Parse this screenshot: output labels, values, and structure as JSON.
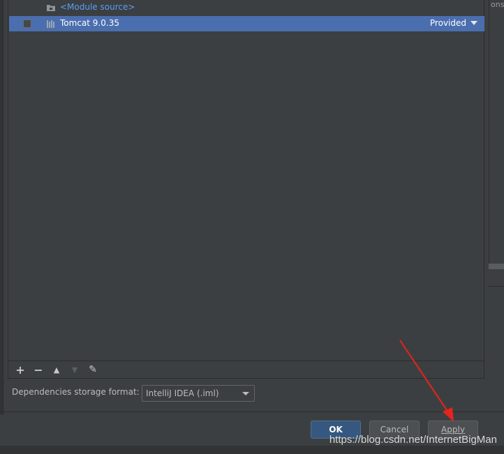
{
  "right_panel": {
    "text": "ons"
  },
  "dependencies": {
    "rows": [
      {
        "label": "<Module source>",
        "scope": "",
        "icon": "folder-icon",
        "selected": false
      },
      {
        "label": "Tomcat 9.0.35",
        "scope": "Provided",
        "icon": "library-icon",
        "selected": true
      }
    ]
  },
  "toolbar": {
    "add": "+",
    "remove": "−",
    "move_up": "▲",
    "move_down": "▼",
    "edit": "✎"
  },
  "storage": {
    "label": "Dependencies storage format:",
    "value": "IntelliJ IDEA (.iml)"
  },
  "buttons": {
    "ok": "OK",
    "cancel": "Cancel",
    "apply": "Apply"
  },
  "watermark": "https://blog.csdn.net/InternetBigMan",
  "colors": {
    "selection": "#4b6eaf",
    "link": "#589df6",
    "annotation": "#e8231b"
  }
}
